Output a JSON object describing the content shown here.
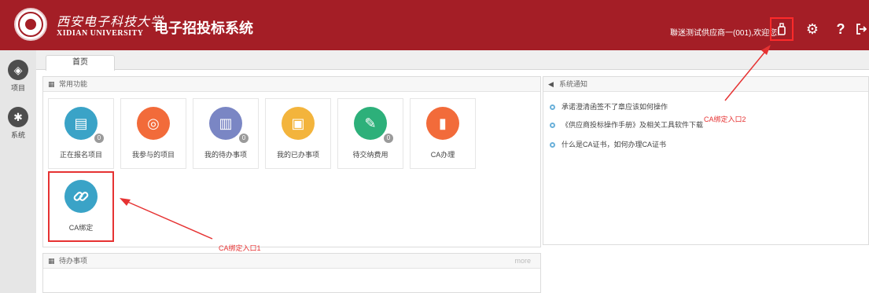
{
  "header": {
    "university_cn": "西安电子科技大学",
    "university_en": "XIDIAN UNIVERSITY",
    "system_title": "电子招投标系统",
    "welcome": "聯迷测试供应商一(001),欢迎您!",
    "icons": [
      "usb-key-icon",
      "gear-icon",
      "help-icon",
      "logout-icon"
    ],
    "brand_color": "#a41e26"
  },
  "sidebar": {
    "items": [
      {
        "label": "项目",
        "icon": "layers-icon"
      },
      {
        "label": "系统",
        "icon": "gear-icon"
      }
    ]
  },
  "tabs": [
    {
      "label": "首页"
    }
  ],
  "common_functions": {
    "title": "常用功能",
    "tiles": [
      {
        "label": "正在报名项目",
        "color": "#3aa3c7",
        "icon": "clipboard-icon",
        "badge": "0"
      },
      {
        "label": "我参与的项目",
        "color": "#f26b3a",
        "icon": "target-icon",
        "badge": ""
      },
      {
        "label": "我的待办事项",
        "color": "#7a86c4",
        "icon": "document-clock-icon",
        "badge": "0"
      },
      {
        "label": "我的已办事项",
        "color": "#f3b43c",
        "icon": "calendar-icon",
        "badge": ""
      },
      {
        "label": "待交纳费用",
        "color": "#2db07a",
        "icon": "edit-icon",
        "badge": "0"
      },
      {
        "label": "CA办理",
        "color": "#f26b3a",
        "icon": "usb-key-icon",
        "badge": ""
      },
      {
        "label": "CA绑定",
        "color": "#3aa3c7",
        "icon": "link-icon",
        "badge": ""
      }
    ]
  },
  "notices": {
    "title": "系统通知",
    "items": [
      "承诺澄清函签不了章应该如何操作",
      "《供应商投标操作手册》及相关工具软件下载",
      "什么是CA证书，如何办理CA证书"
    ]
  },
  "todo": {
    "title": "待办事项",
    "more": "more"
  },
  "annotations": {
    "entry1": "CA绑定入口1",
    "entry2": "CA绑定入口2",
    "color": "#e63232"
  }
}
